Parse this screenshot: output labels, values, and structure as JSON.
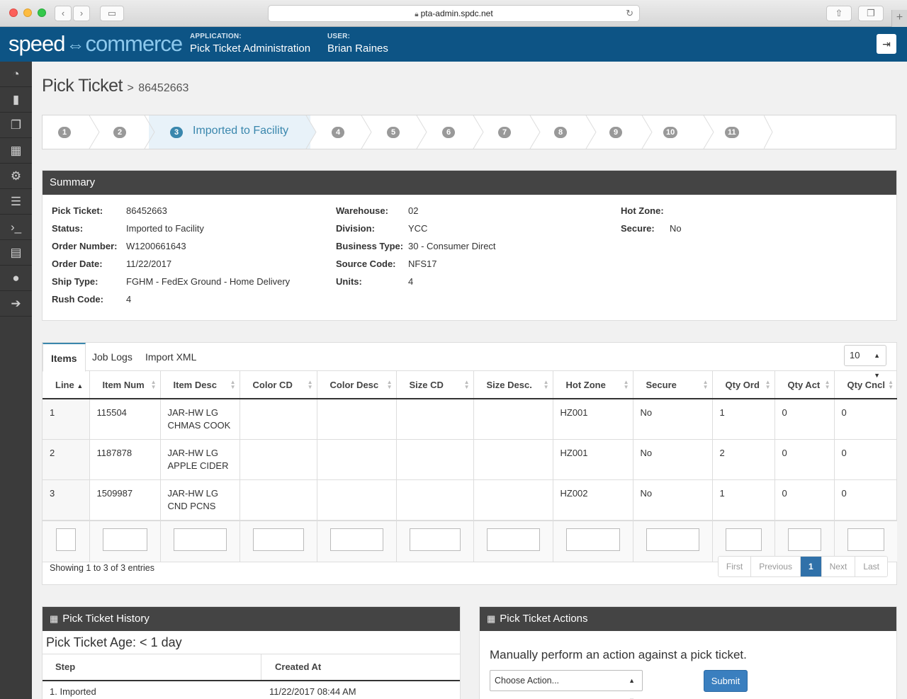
{
  "browser": {
    "url": "pta-admin.spdc.net"
  },
  "header": {
    "logo_left": "speed",
    "logo_right": "commerce",
    "application_label": "APPLICATION:",
    "application_value": "Pick Ticket Administration",
    "user_label": "USER:",
    "user_value": "Brian Raines"
  },
  "sidebar": {
    "items": [
      {
        "icon": "dashboard-icon",
        "glyph": "◔"
      },
      {
        "icon": "file-icon",
        "glyph": "▮"
      },
      {
        "icon": "files-icon",
        "glyph": "❐"
      },
      {
        "icon": "building-icon",
        "glyph": "▦"
      },
      {
        "icon": "cogs-icon",
        "glyph": "⚙"
      },
      {
        "icon": "server-icon",
        "glyph": "☰"
      },
      {
        "icon": "terminal-icon",
        "glyph": "›_"
      },
      {
        "icon": "document-icon",
        "glyph": "▤"
      },
      {
        "icon": "user-icon",
        "glyph": "●"
      },
      {
        "icon": "arrow-right-circle-icon",
        "glyph": "➔"
      }
    ]
  },
  "page": {
    "title": "Pick Ticket",
    "crumb_sep": ">",
    "ticket": "86452663"
  },
  "wizard": {
    "steps": [
      "1",
      "2",
      "3",
      "4",
      "5",
      "6",
      "7",
      "8",
      "9",
      "10",
      "11"
    ],
    "active_step": "3",
    "active_label": "Imported to Facility"
  },
  "summary": {
    "title": "Summary",
    "col1": [
      {
        "key": "Pick Ticket:",
        "value": "86452663"
      },
      {
        "key": "Status:",
        "value": "Imported to Facility"
      },
      {
        "key": "Order Number:",
        "value": "W1200661643"
      },
      {
        "key": "Order Date:",
        "value": "11/22/2017"
      },
      {
        "key": "Ship Type:",
        "value": "FGHM - FedEx Ground - Home Delivery"
      },
      {
        "key": "Rush Code:",
        "value": "4"
      }
    ],
    "col2": [
      {
        "key": "Warehouse:",
        "value": "02"
      },
      {
        "key": "Division:",
        "value": "YCC"
      },
      {
        "key": "Business Type:",
        "value": "30 - Consumer Direct"
      },
      {
        "key": "Source Code:",
        "value": "NFS17"
      },
      {
        "key": "Units:",
        "value": "4"
      }
    ],
    "col3": [
      {
        "key": "Hot Zone:",
        "value": ""
      },
      {
        "key": "Secure:",
        "value": "No"
      }
    ]
  },
  "items": {
    "tabs": [
      "Items",
      "Job Logs",
      "Import XML"
    ],
    "page_size": "10",
    "columns": [
      "Line",
      "Item Num",
      "Item Desc",
      "Color CD",
      "Color Desc",
      "Size CD",
      "Size Desc.",
      "Hot Zone",
      "Secure",
      "Qty Ord",
      "Qty Act",
      "Qty Cncl"
    ],
    "rows": [
      [
        "1",
        "115504",
        "JAR-HW LG CHMAS COOK",
        "",
        "",
        "",
        "",
        "HZ001",
        "No",
        "1",
        "0",
        "0"
      ],
      [
        "2",
        "1187878",
        "JAR-HW LG APPLE CIDER",
        "",
        "",
        "",
        "",
        "HZ001",
        "No",
        "2",
        "0",
        "0"
      ],
      [
        "3",
        "1509987",
        "JAR-HW LG CND PCNS",
        "",
        "",
        "",
        "",
        "HZ002",
        "No",
        "1",
        "0",
        "0"
      ]
    ],
    "showing": "Showing 1 to 3 of 3 entries",
    "pager": {
      "first": "First",
      "previous": "Previous",
      "current": "1",
      "next": "Next",
      "last": "Last"
    }
  },
  "history": {
    "title": "Pick Ticket History",
    "age": "Pick Ticket Age: < 1 day",
    "col_step": "Step",
    "col_created": "Created At",
    "row_step": "1. Imported",
    "row_created": "11/22/2017 08:44 AM"
  },
  "actions": {
    "title": "Pick Ticket Actions",
    "description": "Manually perform an action against a pick ticket.",
    "select_value": "Choose Action...",
    "submit_label": "Submit"
  },
  "colors": {
    "brand": "#0d5485",
    "accent": "#3a87ad",
    "panel_header": "#444444",
    "sidebar": "#3b3b3b"
  }
}
